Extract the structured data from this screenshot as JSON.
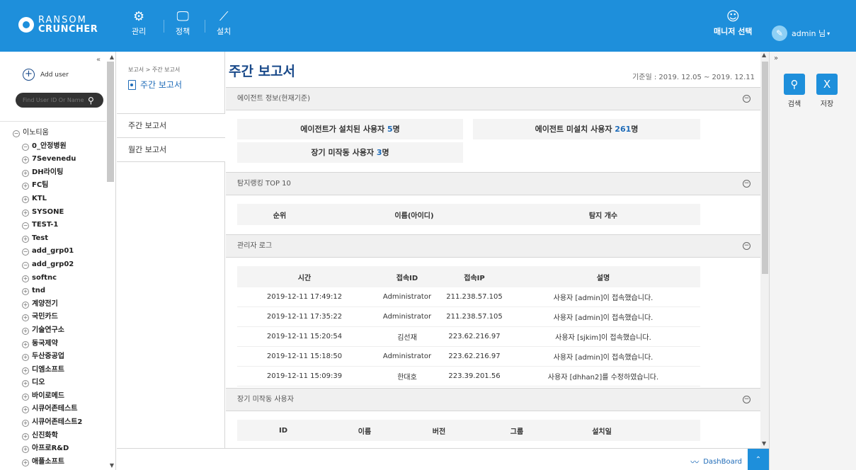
{
  "brand": {
    "line1": "RANSOM",
    "line2": "CRUNCHER",
    "accent": "#1e8fdb"
  },
  "nav": [
    {
      "label": "관리",
      "icon": "gears-icon"
    },
    {
      "label": "정책",
      "icon": "monitor-icon"
    },
    {
      "label": "설치",
      "icon": "wand-icon"
    }
  ],
  "header": {
    "manager_label": "매니저 선택",
    "user_label": "admin 님"
  },
  "sidebar": {
    "add_user": "Add user",
    "search_placeholder": "Find User ID Or Name",
    "tree_root": "이노티움",
    "tree": [
      {
        "label": "0_안정병원",
        "state": "collapse"
      },
      {
        "label": "7Sevenedu",
        "state": "expand"
      },
      {
        "label": "DH라이팅",
        "state": "expand"
      },
      {
        "label": "FC팀",
        "state": "expand"
      },
      {
        "label": "KTL",
        "state": "expand"
      },
      {
        "label": "SYSONE",
        "state": "expand"
      },
      {
        "label": "TEST-1",
        "state": "collapse"
      },
      {
        "label": "Test",
        "state": "expand"
      },
      {
        "label": "add_grp01",
        "state": "collapse"
      },
      {
        "label": "add_grp02",
        "state": "collapse"
      },
      {
        "label": "softnc",
        "state": "expand"
      },
      {
        "label": "tnd",
        "state": "expand"
      },
      {
        "label": "계양전기",
        "state": "expand"
      },
      {
        "label": "국민카드",
        "state": "expand"
      },
      {
        "label": "기술연구소",
        "state": "expand"
      },
      {
        "label": "동국제약",
        "state": "expand"
      },
      {
        "label": "두산중공업",
        "state": "expand"
      },
      {
        "label": "디엠소프트",
        "state": "expand"
      },
      {
        "label": "디오",
        "state": "expand"
      },
      {
        "label": "바이로메드",
        "state": "expand"
      },
      {
        "label": "시큐어존테스트",
        "state": "expand"
      },
      {
        "label": "시큐어존테스트2",
        "state": "expand"
      },
      {
        "label": "신진화학",
        "state": "expand"
      },
      {
        "label": "아프로R&D",
        "state": "expand"
      },
      {
        "label": "애플소프트",
        "state": "expand"
      }
    ]
  },
  "subnav": {
    "breadcrumb": "보고서 > 주간 보고서",
    "title": "주간 보고서",
    "items": [
      "주간 보고서",
      "월간 보고서"
    ]
  },
  "main": {
    "title": "주간 보고서",
    "date_range": "기준일 : 2019. 12.05 ~ 2019. 12.11",
    "agent_section": {
      "title": "에이전트 정보(현재기준)",
      "installed_label": "에이전트가 설치된 사용자 ",
      "installed_count": "5",
      "not_installed_label": "에이전트 미설치 사용자 ",
      "not_installed_count": "261",
      "inactive_label": "장기 미작동 사용자 ",
      "inactive_count": "3",
      "unit": "명"
    },
    "ranking_section": {
      "title": "탐지랭킹 TOP 10",
      "columns": [
        "순위",
        "이름(아이디)",
        "탐지 개수"
      ]
    },
    "admin_log_section": {
      "title": "관리자 로그",
      "columns": [
        "시간",
        "접속ID",
        "접속IP",
        "설명"
      ],
      "rows": [
        [
          "2019-12-11 17:49:12",
          "Administrator",
          "211.238.57.105",
          "사용자 [admin]이 접속했습니다."
        ],
        [
          "2019-12-11 17:35:22",
          "Administrator",
          "211.238.57.105",
          "사용자 [admin]이 접속했습니다."
        ],
        [
          "2019-12-11 15:20:54",
          "김선재",
          "223.62.216.97",
          "사용자 [sjkim]이 접속했습니다."
        ],
        [
          "2019-12-11 15:18:50",
          "Administrator",
          "223.62.216.97",
          "사용자 [admin]이 접속했습니다."
        ],
        [
          "2019-12-11 15:09:39",
          "한대호",
          "223.39.201.56",
          "사용자 [dhhan2]를 수정하였습니다."
        ]
      ]
    },
    "inactive_section": {
      "title": "장기 미작동 사용자",
      "columns": [
        "ID",
        "이름",
        "버전",
        "그룹",
        "설치일"
      ]
    }
  },
  "footer": {
    "dashboard": "DashBoard"
  },
  "right_panel": {
    "search": "검색",
    "save": "저장"
  }
}
